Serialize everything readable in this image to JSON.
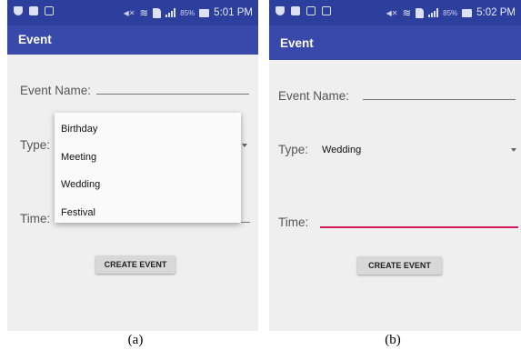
{
  "screens": {
    "a": {
      "status_time": "5:01 PM",
      "status_battery": "85%",
      "app_title": "Event",
      "event_name_label": "Event Name:",
      "type_label": "Type:",
      "time_label": "Time:",
      "dropdown_options": [
        "Birthday",
        "Meeting",
        "Wedding",
        "Festival"
      ],
      "create_button": "CREATE EVENT",
      "caption": "(a)"
    },
    "b": {
      "status_time": "5:02 PM",
      "status_battery": "85%",
      "app_title": "Event",
      "event_name_label": "Event Name:",
      "type_label": "Type:",
      "type_value": "Wedding",
      "time_label": "Time:",
      "create_button": "CREATE EVENT",
      "caption": "(b)"
    }
  },
  "colors": {
    "statusbar": "#2c3f9c",
    "appbar": "#3949ab",
    "background": "#efefef",
    "focus_underline": "#d81b60"
  }
}
